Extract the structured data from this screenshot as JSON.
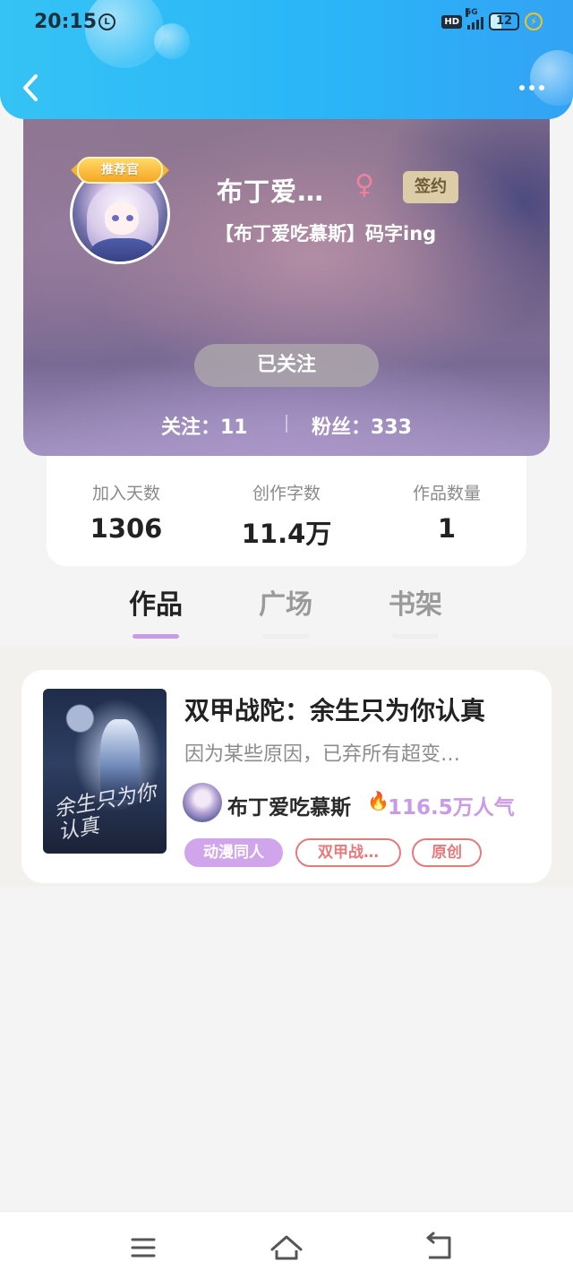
{
  "status_bar": {
    "time": "20:15",
    "notify_glyph": "L",
    "hd": "HD",
    "network": "5G",
    "battery": "12"
  },
  "header": {
    "back_icon": "chevron-left-icon",
    "more_icon": "more-dots-icon"
  },
  "profile": {
    "badge": "推荐官",
    "username": "布丁爱…",
    "gender_symbol": "♀",
    "sign_tag": "签约",
    "bio": "【布丁爱吃慕斯】码字ing",
    "follow_button": "已关注",
    "follow_count": "关注：11",
    "fans_count": "粉丝：333"
  },
  "stats": [
    {
      "label": "加入天数",
      "value": "1306"
    },
    {
      "label": "创作字数",
      "value": "11.4万"
    },
    {
      "label": "作品数量",
      "value": "1"
    }
  ],
  "tabs": [
    {
      "label": "作品",
      "active": true
    },
    {
      "label": "广场",
      "active": false
    },
    {
      "label": "书架",
      "active": false
    }
  ],
  "works": [
    {
      "cover_text": "余生只为你认真",
      "title": "双甲战陀：余生只为你认真",
      "description": "因为某些原因，已弃所有超变…",
      "author": "布丁爱吃慕斯",
      "popularity": "116.5万人气",
      "tags": [
        "动漫同人",
        "双甲战…",
        "原创"
      ]
    }
  ],
  "colors": {
    "header_blue": "#2ab6f7",
    "accent_purple": "#c89ae8",
    "tag_red": "#e8797b",
    "sign_gold": "#dccca7"
  },
  "nav": {
    "menu_icon": "menu-icon",
    "home_icon": "home-icon",
    "back_icon": "back-icon"
  }
}
